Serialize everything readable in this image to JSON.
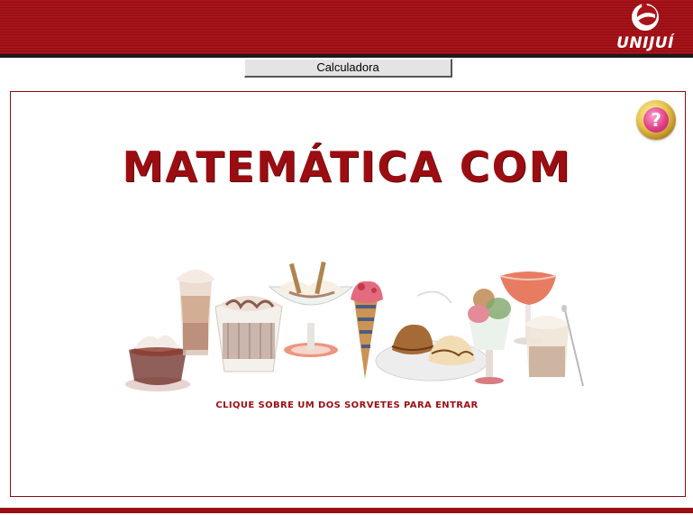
{
  "header": {
    "logo_text": "UNIJUÍ",
    "colors": {
      "band": "#a8141a",
      "rule": "#1a1a1a"
    }
  },
  "toolbar": {
    "calculator_label": "Calculadora"
  },
  "main": {
    "title": "MATEMÁTICA COM",
    "instruction": "CLIQUE SOBRE UM DOS SORVETES PARA ENTRAR",
    "help_symbol": "?",
    "accent_color": "#9c0d12"
  },
  "icecreams": [
    {
      "name": "chocolate-cup-icon"
    },
    {
      "name": "frappe-glass-icon"
    },
    {
      "name": "chocolate-sundae-cup-icon"
    },
    {
      "name": "wafer-sundae-bowl-icon"
    },
    {
      "name": "strawberry-cone-icon"
    },
    {
      "name": "plate-scoops-icon"
    },
    {
      "name": "parfait-glass-icon"
    },
    {
      "name": "strawberry-coupe-icon"
    },
    {
      "name": "vanilla-glass-spoon-icon"
    }
  ]
}
